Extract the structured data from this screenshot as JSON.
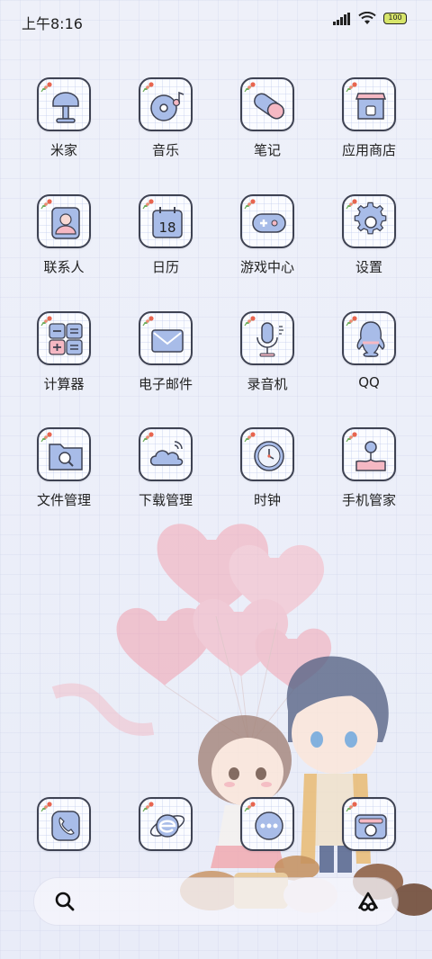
{
  "status_bar": {
    "time": "上午8:16",
    "battery": "100"
  },
  "apps": [
    {
      "label": "米家",
      "icon": "mijia-icon"
    },
    {
      "label": "音乐",
      "icon": "music-icon"
    },
    {
      "label": "笔记",
      "icon": "notes-icon"
    },
    {
      "label": "应用商店",
      "icon": "app-store-icon"
    },
    {
      "label": "联系人",
      "icon": "contacts-icon"
    },
    {
      "label": "日历",
      "icon": "calendar-icon",
      "badge": "18"
    },
    {
      "label": "游戏中心",
      "icon": "game-center-icon"
    },
    {
      "label": "设置",
      "icon": "settings-icon"
    },
    {
      "label": "计算器",
      "icon": "calculator-icon"
    },
    {
      "label": "电子邮件",
      "icon": "email-icon"
    },
    {
      "label": "录音机",
      "icon": "recorder-icon"
    },
    {
      "label": "QQ",
      "icon": "qq-icon"
    },
    {
      "label": "文件管理",
      "icon": "file-manager-icon"
    },
    {
      "label": "下载管理",
      "icon": "download-manager-icon"
    },
    {
      "label": "时钟",
      "icon": "clock-icon"
    },
    {
      "label": "手机管家",
      "icon": "security-icon"
    }
  ],
  "dock": [
    {
      "icon": "phone-icon"
    },
    {
      "icon": "browser-icon"
    },
    {
      "icon": "messages-icon"
    },
    {
      "icon": "camera-icon"
    }
  ],
  "colors": {
    "icon_blue": "#9fb4e4",
    "icon_pink": "#f5b8c3",
    "outline": "#3e4252",
    "flower_red": "#e8654f",
    "leaf_green": "#6fae5d"
  }
}
